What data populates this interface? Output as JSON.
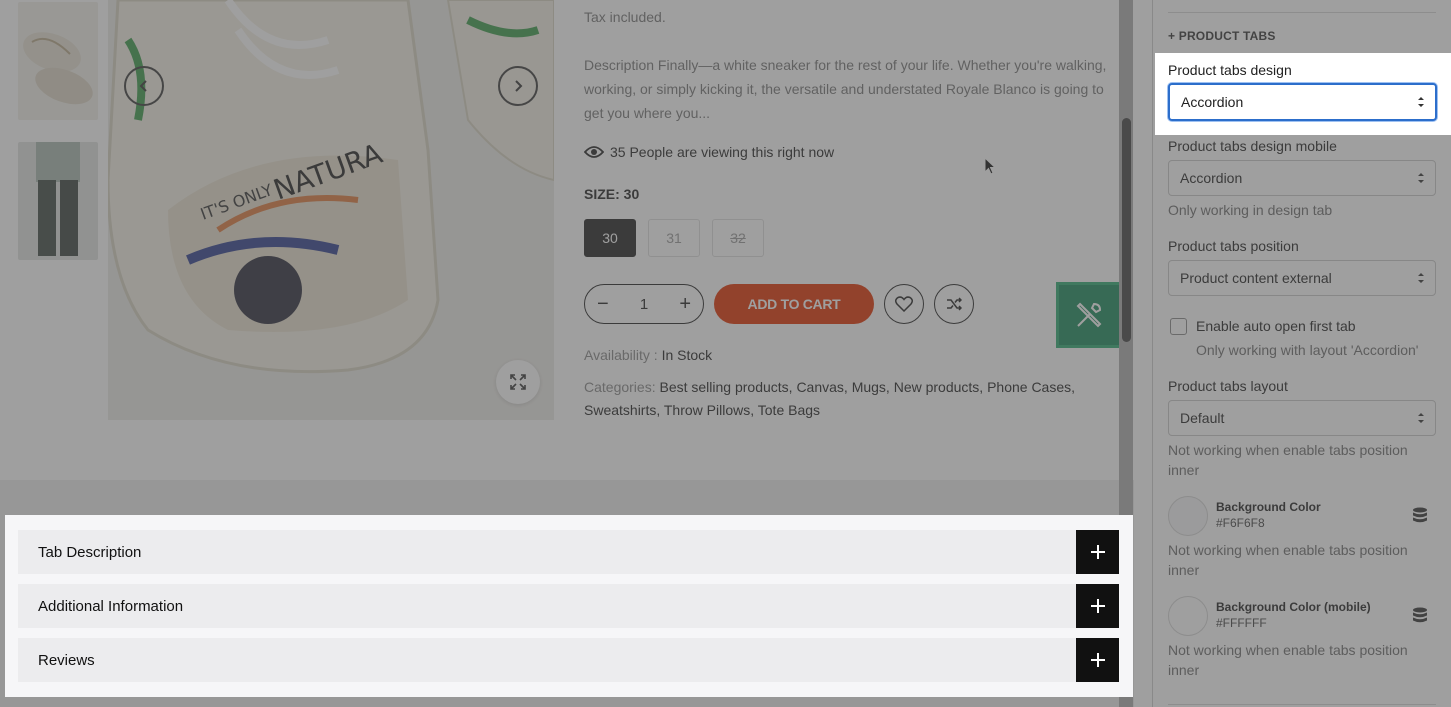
{
  "product": {
    "tax_text": "Tax included.",
    "description": "Description Finally—a white sneaker for the rest of your life. Whether you're walking, working, or simply kicking it, the versatile and understated Royale Blanco is going to get you where you...",
    "viewing_text": "35 People are viewing this right now",
    "size_label": "SIZE: 30",
    "sizes": [
      "30",
      "31",
      "32"
    ],
    "quantity": "1",
    "add_to_cart": "ADD TO CART",
    "availability_label": "Availability :",
    "availability_value": "In Stock",
    "categories_label": "Categories:",
    "categories": "Best selling products, Canvas, Mugs, New products, Phone Cases, Sweatshirts, Throw Pillows, Tote Bags"
  },
  "tabs": [
    {
      "label": "Tab Description"
    },
    {
      "label": "Additional Information"
    },
    {
      "label": "Reviews"
    }
  ],
  "settings": {
    "section_title": "+ PRODUCT TABS",
    "tabs_design": {
      "label": "Product tabs design",
      "value": "Accordion"
    },
    "tabs_design_mobile": {
      "label": "Product tabs design mobile",
      "value": "Accordion",
      "hint": "Only working in design tab"
    },
    "tabs_position": {
      "label": "Product tabs position",
      "value": "Product content external"
    },
    "auto_open": {
      "label": "Enable auto open first tab",
      "hint": "Only working with layout 'Accordion'",
      "checked": false
    },
    "tabs_layout": {
      "label": "Product tabs layout",
      "value": "Default",
      "hint": "Not working when enable tabs position inner"
    },
    "bg_color": {
      "label": "Background Color",
      "value": "#F6F6F8",
      "hint": "Not working when enable tabs position inner"
    },
    "bg_color_mobile": {
      "label": "Background Color (mobile)",
      "value": "#FFFFFF",
      "hint": "Not working when enable tabs position inner"
    }
  },
  "colors": {
    "accent": "#2c6ecb",
    "add_to_cart": "#e23200",
    "fab": "#1a8a5b"
  }
}
